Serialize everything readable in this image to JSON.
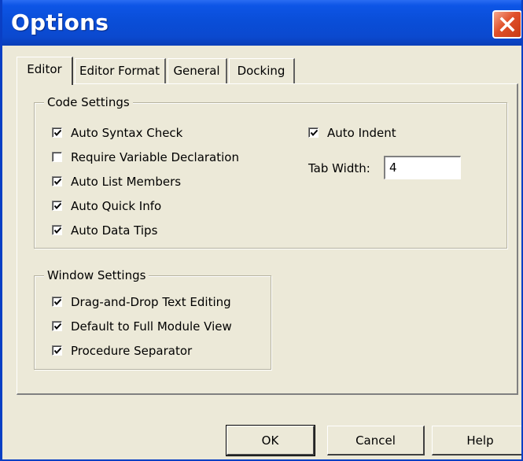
{
  "window": {
    "title": "Options"
  },
  "tabs": [
    {
      "label": "Editor",
      "active": true
    },
    {
      "label": "Editor Format",
      "active": false
    },
    {
      "label": "General",
      "active": false
    },
    {
      "label": "Docking",
      "active": false
    }
  ],
  "code_settings": {
    "label": "Code Settings",
    "options": [
      {
        "label": "Auto Syntax Check",
        "checked": true
      },
      {
        "label": "Require Variable Declaration",
        "checked": false
      },
      {
        "label": "Auto List Members",
        "checked": true
      },
      {
        "label": "Auto Quick Info",
        "checked": true
      },
      {
        "label": "Auto Data Tips",
        "checked": true
      }
    ],
    "auto_indent": {
      "label": "Auto Indent",
      "checked": true
    },
    "tab_width": {
      "label": "Tab Width:",
      "value": "4"
    }
  },
  "window_settings": {
    "label": "Window Settings",
    "options": [
      {
        "label": "Drag-and-Drop Text Editing",
        "checked": true
      },
      {
        "label": "Default to Full Module View",
        "checked": true
      },
      {
        "label": "Procedure Separator",
        "checked": true
      }
    ]
  },
  "buttons": {
    "ok": "OK",
    "cancel": "Cancel",
    "help": "Help"
  },
  "colors": {
    "titlebar": "#0a4ed8",
    "dialog_bg": "#ece9d8",
    "close": "#e0502a"
  },
  "icons": {
    "close": "close-icon",
    "check": "check-icon"
  }
}
